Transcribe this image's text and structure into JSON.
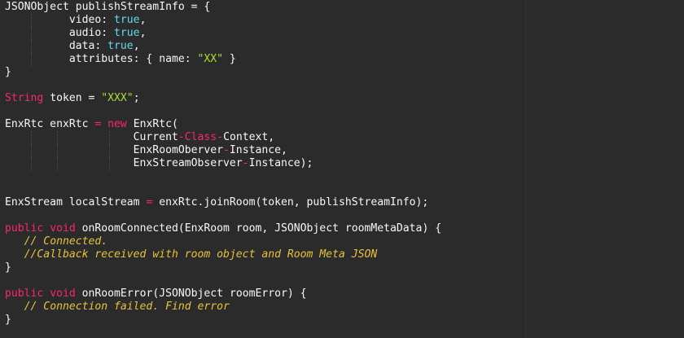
{
  "colors": {
    "background": "#2b2b2b",
    "plain": "#f8f8f2",
    "keyword": "#f92672",
    "value": "#66d9ef",
    "string": "#a6e22e",
    "comment": "#e6c33d"
  },
  "code_lines": [
    {
      "tokens": [
        {
          "t": "plain",
          "v": "JSONObject publishStreamInfo = {"
        }
      ]
    },
    {
      "guides": [
        1
      ],
      "tokens": [
        {
          "t": "plain",
          "v": "          video: "
        },
        {
          "t": "val",
          "v": "true"
        },
        {
          "t": "plain",
          "v": ","
        }
      ]
    },
    {
      "guides": [
        1
      ],
      "tokens": [
        {
          "t": "plain",
          "v": "          audio: "
        },
        {
          "t": "val",
          "v": "true"
        },
        {
          "t": "plain",
          "v": ","
        }
      ]
    },
    {
      "guides": [
        1
      ],
      "tokens": [
        {
          "t": "plain",
          "v": "          data: "
        },
        {
          "t": "val",
          "v": "true"
        },
        {
          "t": "plain",
          "v": ","
        }
      ]
    },
    {
      "guides": [
        1
      ],
      "tokens": [
        {
          "t": "plain",
          "v": "          attributes: { name: "
        },
        {
          "t": "str",
          "v": "\"XX\""
        },
        {
          "t": "plain",
          "v": " }"
        }
      ]
    },
    {
      "tokens": [
        {
          "t": "plain",
          "v": "}"
        }
      ]
    },
    {
      "tokens": []
    },
    {
      "tokens": [
        {
          "t": "type",
          "v": "String"
        },
        {
          "t": "plain",
          "v": " token = "
        },
        {
          "t": "str",
          "v": "\"XXX\""
        },
        {
          "t": "plain",
          "v": ";"
        }
      ]
    },
    {
      "tokens": []
    },
    {
      "tokens": [
        {
          "t": "plain",
          "v": "EnxRtc enxRtc "
        },
        {
          "t": "kw",
          "v": "="
        },
        {
          "t": "plain",
          "v": " "
        },
        {
          "t": "kw",
          "v": "new"
        },
        {
          "t": "plain",
          "v": " EnxRtc("
        }
      ]
    },
    {
      "guides": [
        1,
        2,
        3
      ],
      "tokens": [
        {
          "t": "plain",
          "v": "                    Current"
        },
        {
          "t": "kw",
          "v": "-"
        },
        {
          "t": "type",
          "v": "Class"
        },
        {
          "t": "kw",
          "v": "-"
        },
        {
          "t": "plain",
          "v": "Context,"
        }
      ]
    },
    {
      "guides": [
        1,
        2,
        3
      ],
      "tokens": [
        {
          "t": "plain",
          "v": "                    EnxRoomOberver"
        },
        {
          "t": "kw",
          "v": "-"
        },
        {
          "t": "plain",
          "v": "Instance,"
        }
      ]
    },
    {
      "guides": [
        1,
        2,
        3
      ],
      "tokens": [
        {
          "t": "plain",
          "v": "                    EnxStreamObserver"
        },
        {
          "t": "kw",
          "v": "-"
        },
        {
          "t": "plain",
          "v": "Instance);"
        }
      ]
    },
    {
      "tokens": []
    },
    {
      "tokens": []
    },
    {
      "tokens": [
        {
          "t": "plain",
          "v": "EnxStream localStream "
        },
        {
          "t": "kw",
          "v": "="
        },
        {
          "t": "plain",
          "v": " enxRtc.joinRoom(token, publishStreamInfo);"
        }
      ]
    },
    {
      "tokens": []
    },
    {
      "tokens": [
        {
          "t": "kw",
          "v": "public"
        },
        {
          "t": "plain",
          "v": " "
        },
        {
          "t": "kw",
          "v": "void"
        },
        {
          "t": "plain",
          "v": " onRoomConnected(EnxRoom room, JSONObject roomMetaData) {"
        }
      ]
    },
    {
      "tokens": [
        {
          "t": "plain",
          "v": "   "
        },
        {
          "t": "cm",
          "v": "// Connected."
        }
      ]
    },
    {
      "tokens": [
        {
          "t": "plain",
          "v": "   "
        },
        {
          "t": "cm",
          "v": "//Callback received with room object and Room Meta JSON"
        }
      ]
    },
    {
      "tokens": [
        {
          "t": "plain",
          "v": "}"
        }
      ]
    },
    {
      "tokens": []
    },
    {
      "tokens": [
        {
          "t": "kw",
          "v": "public"
        },
        {
          "t": "plain",
          "v": " "
        },
        {
          "t": "kw",
          "v": "void"
        },
        {
          "t": "plain",
          "v": " onRoomError(JSONObject roomError) {"
        }
      ]
    },
    {
      "tokens": [
        {
          "t": "plain",
          "v": "   "
        },
        {
          "t": "cm",
          "v": "// Connection failed. Find error"
        }
      ]
    },
    {
      "tokens": [
        {
          "t": "plain",
          "v": "}"
        }
      ]
    }
  ]
}
